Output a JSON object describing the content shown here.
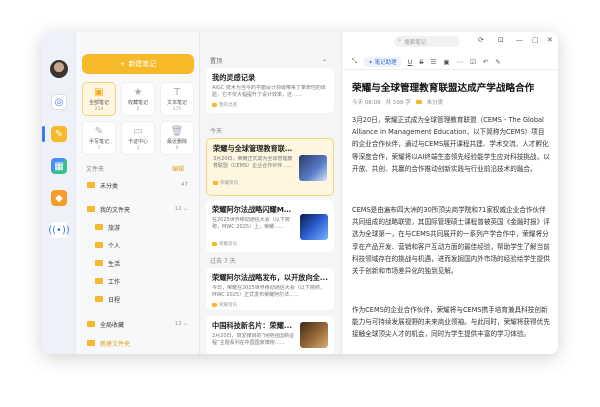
{
  "sidebar_rail": {
    "icons": [
      "avatar",
      "app-icon-blue",
      "notes-icon",
      "app-icon-multi",
      "app-icon-orange",
      "broadcast-icon"
    ]
  },
  "folders": {
    "new_note": "新建笔记",
    "grid": [
      {
        "label": "全部笔记",
        "count": "214"
      },
      {
        "label": "收藏笔记",
        "count": "2"
      },
      {
        "label": "文本笔记",
        "count": "175"
      },
      {
        "label": "手写笔记",
        "count": "7"
      },
      {
        "label": "卡证中心",
        "count": "1"
      },
      {
        "label": "最近删除",
        "count": "0"
      }
    ],
    "section_label": "文件夹",
    "section_action": "编辑",
    "uncategorized": {
      "label": "未分类",
      "count": "47"
    },
    "my_folders": {
      "label": "我的文件夹",
      "count": "12"
    },
    "subfolders": [
      "旅游",
      "个人",
      "生活",
      "工作",
      "日程"
    ],
    "global_fav": {
      "label": "全局收藏",
      "count": "12"
    },
    "new_folder": "新建文件夹"
  },
  "note_list": {
    "header": "置顶",
    "today_label": "今天",
    "earlier_label": "过去 7 天",
    "items": [
      {
        "title": "我的灵感记录",
        "snippet": "AIGC 技术为当今的平面设计领域带来了革命性的体验，它不仅大幅提升了设计效率，还……",
        "tag": "我的灵感"
      },
      {
        "title": "荣耀与全球管理教育联盟达...",
        "snippet": "3月20日，荣耀正式成为全球管理教育联盟（CEMS）企业合作伙伴……",
        "tag": "荣耀资讯"
      },
      {
        "title": "荣耀阿尔法战略闪耀MWC...",
        "snippet": "在2025世界移动通信大会（以下简称，MWC 2025）上，荣耀……",
        "tag": "荣耀资讯"
      },
      {
        "title": "荣耀阿尔法战略发布，以开放向全...",
        "snippet": "今日，荣耀在2025世界移动通信大会（以下简称，MWC 2025）正式发布荣耀阿尔法……",
        "tag": "荣耀资讯"
      },
      {
        "title": "中国科技新名片：荣耀...",
        "snippet": "2月20日，衰爱媒目的“网络强国新征程”主题系列在中国国家博物……",
        "tag": "荣耀资讯"
      }
    ]
  },
  "editor": {
    "search_placeholder": "搜索笔记",
    "note_detect": "笔记助理",
    "title": "荣耀与全球管理教育联盟达成产学战略合作",
    "meta_time": "今天 08:08",
    "meta_words": "共 599 字",
    "meta_folder": "未分类",
    "paragraphs": [
      "3月20日，荣耀正式成为全球管理教育联盟（CEMS - The Global Alliance in Management Education，以下简称为CEMS）项目的企业合作伙伴，通过与CEMS展开课程共建、学术交流、人才孵化等深度合作，荣耀将以AI终端生态领先经验能学生应对科技挑战，以开放、共创、共赢的合作推动创新实践与行业前沿技术的融合。",
      "CEMS是由遍布四大洲的30所顶尖商学院和71家权威企业合作伙伴共同组成的战略联盟，其国际管理硕士课程曾被英国《金融时报》评选为全球第一，在与CEMS共同展开的一系列产学合作中，荣耀将分享在产品开发、营销和客户互动方面的最佳经验，帮助学生了解当前科技领域存在的挑战与机遇，进而发掘国内外市场的经验给学生提供关于创新和市场差异化的独到见解。",
      "作为CEMS的企业合作伙伴，荣耀将与CEMS携手培育兼具科技创新能力与可持续发展视野的未来商业领袖。与此同时，荣耀将获得优先接触全球顶尖人才的机会，同时为学生提供丰富的学习体验。"
    ]
  },
  "colors": {
    "accent": "#f6b92a",
    "brand_blue": "#3a7bf0"
  }
}
